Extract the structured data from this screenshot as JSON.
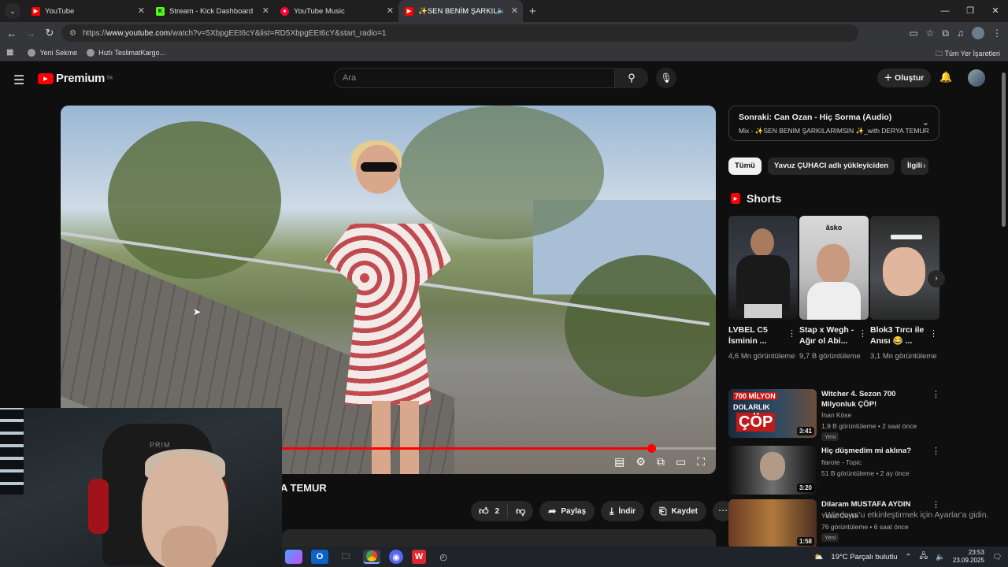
{
  "browser": {
    "tabs": [
      {
        "label": "YouTube",
        "favicon": "youtube-icon",
        "color": "#ff0000",
        "active": false
      },
      {
        "label": "Stream - Kick Dashboard",
        "favicon": "kick-icon",
        "color": "#53fc18",
        "active": false
      },
      {
        "label": "YouTube Music",
        "favicon": "youtube-music-icon",
        "color": "#ff0033",
        "active": false
      },
      {
        "label": "✨SEN BENİM ŞARKILARIM",
        "favicon": "youtube-icon",
        "color": "#ff0000",
        "active": true
      }
    ],
    "url_prefix": "https://",
    "url_host": "www.youtube.com",
    "url_path": "/watch?v=5XbpgEEt6cY&list=RD5XbpgEEt6cY&start_radio=1",
    "bookmarks": [
      {
        "label": "Yeni Sekme"
      },
      {
        "label": "Hızlı TeslimatKargo..."
      }
    ],
    "all_bookmarks": "Tüm Yer İşaretleri"
  },
  "youtube": {
    "logo_text": "Premium",
    "logo_sup": "TR",
    "search_placeholder": "Ara",
    "create_label": "Oluştur",
    "video": {
      "progress": 0.902,
      "title_fragment": "A TEMUR",
      "like_count": "2",
      "share_label": "Paylaş",
      "download_label": "İndir",
      "save_label": "Kaydet"
    },
    "up_next": {
      "title": "Sonraki: Can Ozan - Hiç Sorma (Audio)",
      "subtitle": "Mix - ✨SEN BENİM ŞARKILARIMSIN ✨_with DERYA TEMUR"
    },
    "chips": [
      "Tümü",
      "Yavuz ÇUHACI adlı yükleyiciden",
      "İlgili"
    ],
    "shorts_heading": "Shorts",
    "shorts": [
      {
        "title": "LVBEL C5 İsminin ...",
        "views": "4,6 Mn görüntüleme",
        "overlay": ""
      },
      {
        "title": "Stap x Wegh - Ağır ol Abi...",
        "views": "9,7 B görüntüleme",
        "overlay": "âsko"
      },
      {
        "title": "Blok3 Tırcı ile Anısı 😂 ...",
        "views": "3,1 Mn görüntüleme",
        "overlay": ""
      }
    ],
    "recommendations": [
      {
        "title": "Witcher 4. Sezon 700 Milyonluk ÇÖP!",
        "channel": "İnan Köse",
        "meta": "1,9 B görüntüleme • 2 saat önce",
        "badge": "Yeni",
        "duration": "3:41",
        "thumb_text_1": "700 MİLYON",
        "thumb_text_2": "DOLARLIK",
        "thumb_text_3": "ÇÖP"
      },
      {
        "title": "Hiç düşmedim mi aklına?",
        "channel": "flarote - Topic",
        "meta": "51 B görüntüleme • 2 ay önce",
        "badge": "",
        "duration": "3:20",
        "thumb_text_1": "",
        "thumb_text_2": "",
        "thumb_text_3": ""
      },
      {
        "title": "Dilaram MUSTAFA AYDIN",
        "channel": "Yusuf Ceylik",
        "meta": "76 görüntüleme • 6 saat önce",
        "badge": "Yeni",
        "duration": "1:58",
        "thumb_text_1": "",
        "thumb_text_2": "",
        "thumb_text_3": ""
      }
    ]
  },
  "webcam": {
    "chair_text": "PRIM"
  },
  "windows": {
    "toast": "Windows'u etkinleştirmek için Ayarlar'a gidin.",
    "weather": "19°C  Parçalı bulutlu",
    "time": "23:53",
    "date": "23.09.2025"
  }
}
